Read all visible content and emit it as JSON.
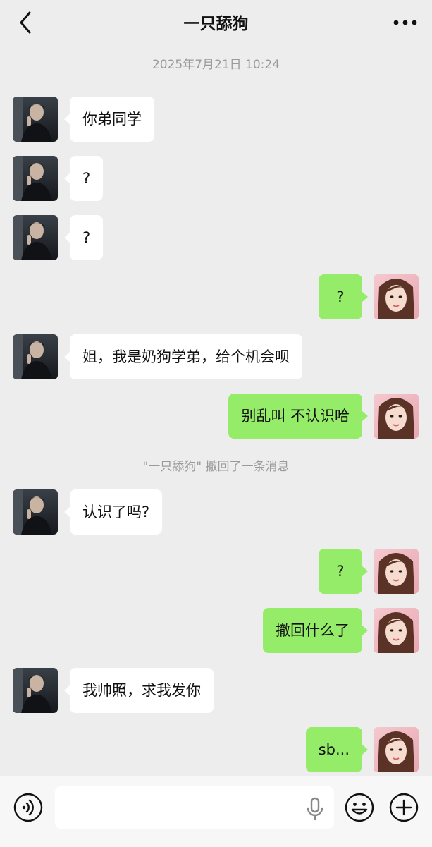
{
  "header": {
    "title": "一只舔狗",
    "back_icon": "chevron-left-icon",
    "more_icon": "more-dots-icon"
  },
  "timestamp": "2025年7月21日 10:24",
  "system_message": "\"一只舔狗\" 撤回了一条消息",
  "messages": [
    {
      "side": "in",
      "text": "你弟同学"
    },
    {
      "side": "in",
      "text": "?"
    },
    {
      "side": "in",
      "text": "?"
    },
    {
      "side": "out",
      "text": "?"
    },
    {
      "side": "in",
      "text": "姐，我是奶狗学弟，给个机会呗"
    },
    {
      "side": "out",
      "text": "别乱叫 不认识哈"
    },
    {
      "side": "in",
      "text": "认识了吗?"
    },
    {
      "side": "out",
      "text": "?"
    },
    {
      "side": "out",
      "text": "撤回什么了"
    },
    {
      "side": "in",
      "text": "我帅照，求我发你"
    },
    {
      "side": "out",
      "text": "sb..."
    }
  ],
  "input_bar": {
    "voice_icon": "voice-icon",
    "mic_icon": "microphone-icon",
    "emoji_icon": "emoji-icon",
    "plus_icon": "plus-icon"
  },
  "colors": {
    "background": "#ededed",
    "incoming_bubble": "#ffffff",
    "outgoing_bubble": "#95ec69"
  }
}
